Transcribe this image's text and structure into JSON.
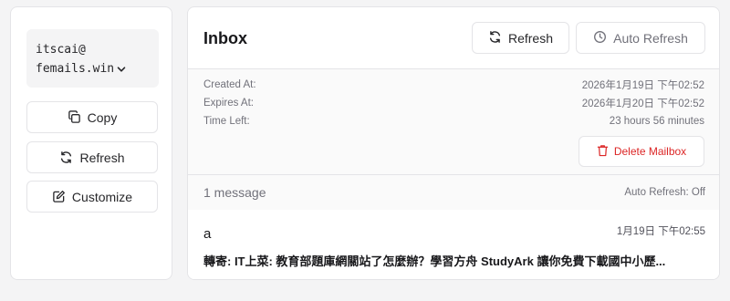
{
  "sidebar": {
    "address_line1": "itscai@",
    "address_line2": "femails.win",
    "copy_label": "Copy",
    "refresh_label": "Refresh",
    "customize_label": "Customize"
  },
  "inbox": {
    "title": "Inbox",
    "refresh_label": "Refresh",
    "auto_refresh_label": "Auto Refresh"
  },
  "mailbox_info": {
    "created_label": "Created At:",
    "created_value": "2026年1月19日 下午02:52",
    "expires_label": "Expires At:",
    "expires_value": "2026年1月20日 下午02:52",
    "time_left_label": "Time Left:",
    "time_left_value": "23 hours 56 minutes",
    "delete_label": "Delete Mailbox"
  },
  "messages": {
    "count_label": "1 message",
    "auto_refresh_status": "Auto Refresh: Off",
    "items": [
      {
        "from": "a",
        "time": "1月19日 下午02:55",
        "subject": "轉寄: IT上菜: 教育部題庫網關站了怎麼辦？學習方舟 StudyArk 讓你免費下載國中小歷..."
      }
    ]
  },
  "colors": {
    "danger": "#dc2626",
    "border": "#e4e4e7",
    "muted": "#71717a",
    "background": "#f4f4f5"
  },
  "icons": [
    "copy-icon",
    "refresh-icon",
    "edit-icon",
    "clock-icon",
    "trash-icon",
    "chevron-down-icon"
  ]
}
